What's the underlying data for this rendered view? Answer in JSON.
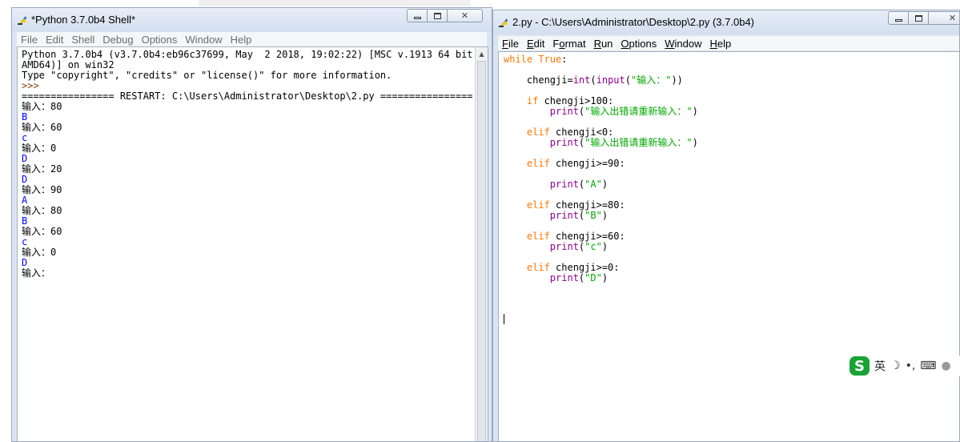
{
  "shell_window": {
    "title": "*Python 3.7.0b4 Shell*",
    "menu": [
      "File",
      "Edit",
      "Shell",
      "Debug",
      "Options",
      "Window",
      "Help"
    ],
    "lines": [
      {
        "text": "Python 3.7.0b4 (v3.7.0b4:eb96c37699, May  2 2018, 19:02:22) [MSC v.1913 64 bit (",
        "type": "plain"
      },
      {
        "text": "AMD64)] on win32",
        "type": "plain"
      },
      {
        "text": "Type \"copyright\", \"credits\" or \"license()\" for more information.",
        "type": "plain"
      },
      {
        "text": ">>> ",
        "type": "prompt"
      },
      {
        "text": "================ RESTART: C:\\Users\\Administrator\\Desktop\\2.py ================",
        "type": "plain"
      },
      {
        "text": "输入：80",
        "type": "plain"
      },
      {
        "text": "B",
        "type": "out"
      },
      {
        "text": "输入：60",
        "type": "plain"
      },
      {
        "text": "c",
        "type": "out"
      },
      {
        "text": "输入：0",
        "type": "plain"
      },
      {
        "text": "D",
        "type": "out"
      },
      {
        "text": "输入：20",
        "type": "plain"
      },
      {
        "text": "D",
        "type": "out"
      },
      {
        "text": "输入：90",
        "type": "plain"
      },
      {
        "text": "A",
        "type": "out"
      },
      {
        "text": "输入：80",
        "type": "plain"
      },
      {
        "text": "B",
        "type": "out"
      },
      {
        "text": "输入：60",
        "type": "plain"
      },
      {
        "text": "c",
        "type": "out"
      },
      {
        "text": "输入：0",
        "type": "plain"
      },
      {
        "text": "D",
        "type": "out"
      },
      {
        "text": "输入：",
        "type": "plain"
      }
    ]
  },
  "editor_window": {
    "title": "2.py - C:\\Users\\Administrator\\Desktop\\2.py (3.7.0b4)",
    "menu": [
      {
        "label": "File",
        "underline_index": 0
      },
      {
        "label": "Edit",
        "underline_index": 0
      },
      {
        "label": "Format",
        "underline_index": 1
      },
      {
        "label": "Run",
        "underline_index": 0
      },
      {
        "label": "Options",
        "underline_index": 0
      },
      {
        "label": "Window",
        "underline_index": 0
      },
      {
        "label": "Help",
        "underline_index": 0
      }
    ],
    "code_lines": [
      [
        {
          "t": "while",
          "c": "kw"
        },
        {
          "t": " "
        },
        {
          "t": "True",
          "c": "kw"
        },
        {
          "t": ":"
        }
      ],
      [],
      [
        {
          "t": "    chengji="
        },
        {
          "t": "int",
          "c": "bi"
        },
        {
          "t": "("
        },
        {
          "t": "input",
          "c": "bi"
        },
        {
          "t": "("
        },
        {
          "t": "\"输入：\"",
          "c": "st"
        },
        {
          "t": "))"
        }
      ],
      [],
      [
        {
          "t": "    "
        },
        {
          "t": "if",
          "c": "kw"
        },
        {
          "t": " chengji>100:"
        }
      ],
      [
        {
          "t": "        "
        },
        {
          "t": "print",
          "c": "bi"
        },
        {
          "t": "("
        },
        {
          "t": "\"输入出错请重新输入：\"",
          "c": "st"
        },
        {
          "t": ")"
        }
      ],
      [],
      [
        {
          "t": "    "
        },
        {
          "t": "elif",
          "c": "kw"
        },
        {
          "t": " chengji<0:"
        }
      ],
      [
        {
          "t": "        "
        },
        {
          "t": "print",
          "c": "bi"
        },
        {
          "t": "("
        },
        {
          "t": "\"输入出错请重新输入：\"",
          "c": "st"
        },
        {
          "t": ")"
        }
      ],
      [],
      [
        {
          "t": "    "
        },
        {
          "t": "elif",
          "c": "kw"
        },
        {
          "t": " chengji>=90:"
        }
      ],
      [],
      [
        {
          "t": "        "
        },
        {
          "t": "print",
          "c": "bi"
        },
        {
          "t": "("
        },
        {
          "t": "\"A\"",
          "c": "st"
        },
        {
          "t": ")"
        }
      ],
      [],
      [
        {
          "t": "    "
        },
        {
          "t": "elif",
          "c": "kw"
        },
        {
          "t": " chengji>=80:"
        }
      ],
      [
        {
          "t": "        "
        },
        {
          "t": "print",
          "c": "bi"
        },
        {
          "t": "("
        },
        {
          "t": "\"B\"",
          "c": "st"
        },
        {
          "t": ")"
        }
      ],
      [],
      [
        {
          "t": "    "
        },
        {
          "t": "elif",
          "c": "kw"
        },
        {
          "t": " chengji>=60:"
        }
      ],
      [
        {
          "t": "        "
        },
        {
          "t": "print",
          "c": "bi"
        },
        {
          "t": "("
        },
        {
          "t": "\"c\"",
          "c": "st"
        },
        {
          "t": ")"
        }
      ],
      [],
      [
        {
          "t": "    "
        },
        {
          "t": "elif",
          "c": "kw"
        },
        {
          "t": " chengji>=0:"
        }
      ],
      [
        {
          "t": "        "
        },
        {
          "t": "print",
          "c": "bi"
        },
        {
          "t": "("
        },
        {
          "t": "\"D\"",
          "c": "st"
        },
        {
          "t": ")"
        }
      ]
    ]
  },
  "ime_toolbar": {
    "logo": "S",
    "mode": "英",
    "icons": [
      "moon-icon",
      "punctuation-icon",
      "keyboard-icon",
      "user-icon"
    ]
  },
  "colors": {
    "keyword": "#ff7700",
    "builtin": "#900090",
    "string": "#00aa00",
    "output": "#0000ff",
    "prompt": "#7f3f00",
    "ime_green": "#19a335"
  }
}
